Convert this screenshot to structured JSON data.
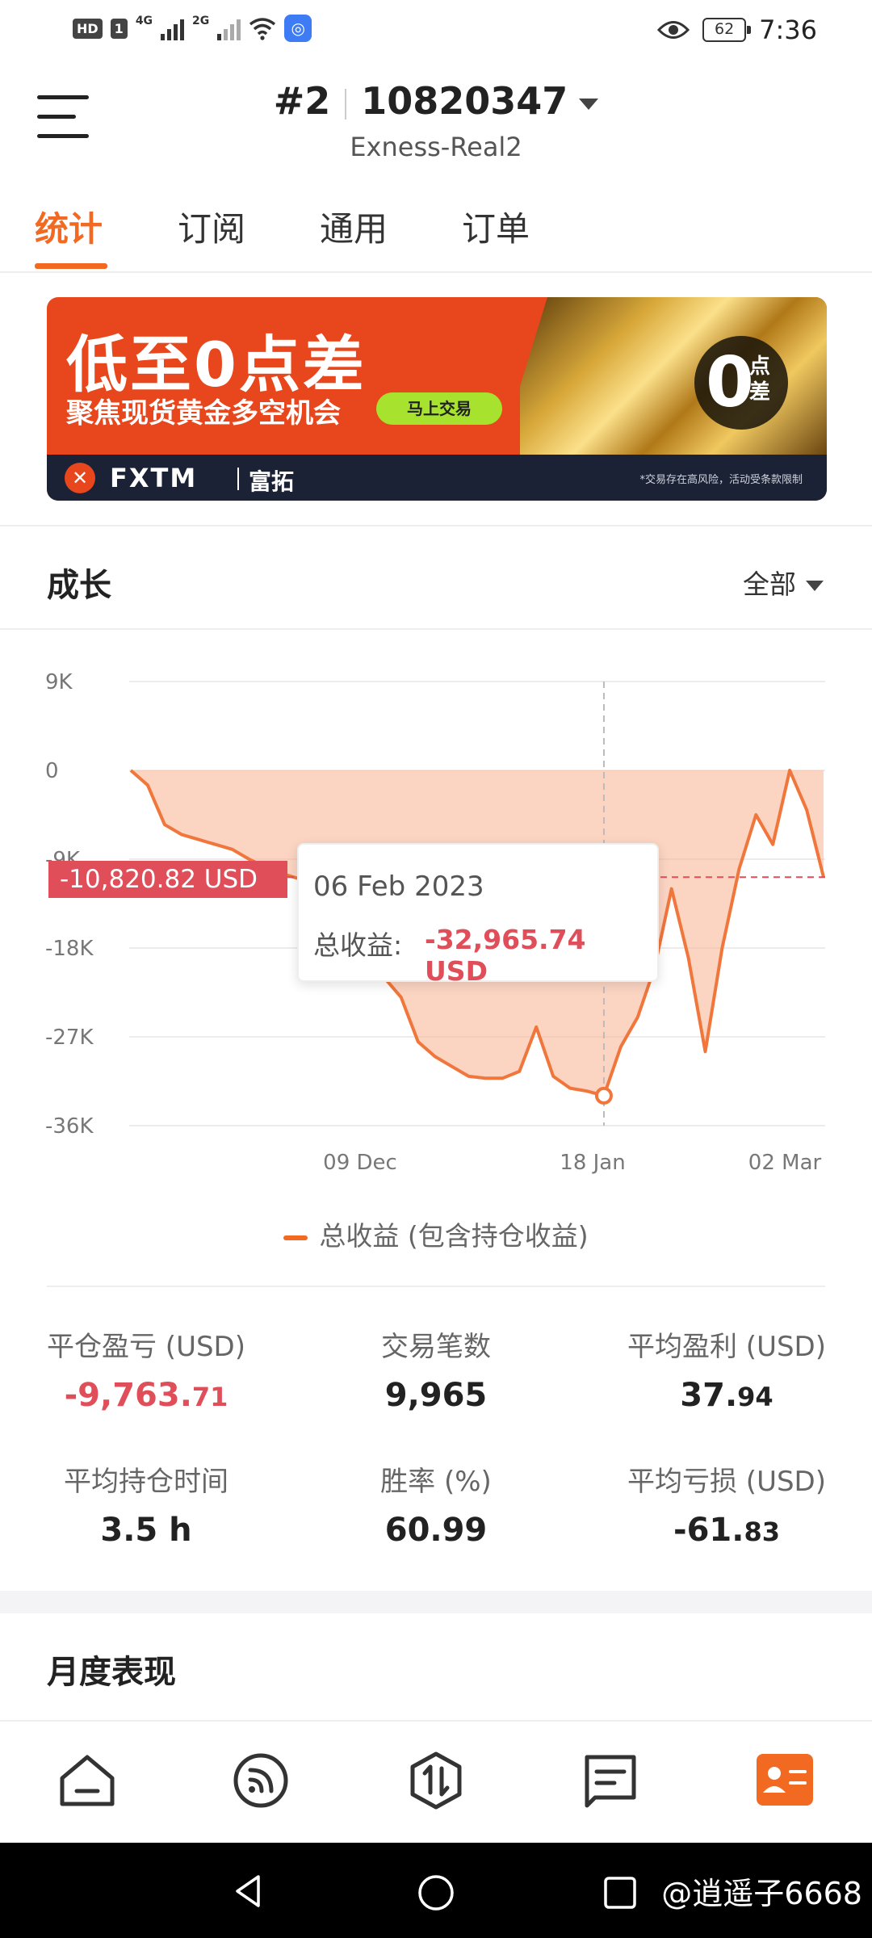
{
  "status_bar": {
    "hd": "HD",
    "sim": "1",
    "net1": "4G",
    "net2": "2G",
    "battery": "62",
    "time": "7:36"
  },
  "header": {
    "account_index": "#2",
    "account_number": "10820347",
    "server": "Exness-Real2"
  },
  "tabs": [
    {
      "label": "统计",
      "active": true
    },
    {
      "label": "订阅"
    },
    {
      "label": "通用"
    },
    {
      "label": "订单"
    }
  ],
  "banner": {
    "headline": "低至0点差",
    "subline": "聚焦现货黄金多空机会",
    "cta": "马上交易",
    "badge_big": "0",
    "badge_small": "点差",
    "brand": "FXTM",
    "brand_cn": "富拓",
    "note": "*交易存在高风险，活动受条款限制"
  },
  "growth": {
    "title": "成长",
    "range": "全部",
    "price_tag": "-10,820.82 USD",
    "tooltip_date": "06 Feb 2023",
    "tooltip_label": "总收益:",
    "tooltip_value": "-32,965.74 USD",
    "legend": "总收益 (包含持仓收益)"
  },
  "chart_data": {
    "type": "area",
    "series": [
      {
        "name": "总收益 (包含持仓收益)",
        "x": [
          "28 Oct",
          "30 Oct",
          "02 Nov",
          "05 Nov",
          "08 Nov",
          "12 Nov",
          "16 Nov",
          "20 Nov",
          "24 Nov",
          "28 Nov",
          "02 Dec",
          "09 Dec",
          "14 Dec",
          "19 Dec",
          "24 Dec",
          "29 Dec",
          "02 Jan",
          "06 Jan",
          "09 Jan",
          "12 Jan",
          "15 Jan",
          "18 Jan",
          "22 Jan",
          "25 Jan",
          "27 Jan",
          "29 Jan",
          "01 Feb",
          "04 Feb",
          "06 Feb",
          "09 Feb",
          "12 Feb",
          "15 Feb",
          "16 Feb",
          "18 Feb",
          "20 Feb",
          "22 Feb",
          "24 Feb",
          "26 Feb",
          "28 Feb",
          "01 Mar",
          "02 Mar",
          "03 Mar"
        ],
        "values": [
          0,
          -1500,
          -5500,
          -6500,
          -7000,
          -7500,
          -8000,
          -9000,
          -9800,
          -10500,
          -11000,
          -12000,
          -13500,
          -15500,
          -18500,
          -21000,
          -23000,
          -27500,
          -29000,
          -30000,
          -31000,
          -31200,
          -31200,
          -30500,
          -26000,
          -31000,
          -32200,
          -32500,
          -32966,
          -28000,
          -25000,
          -20000,
          -12000,
          -19000,
          -28500,
          -18000,
          -10000,
          -4500,
          -7500,
          0,
          -4000,
          -10821
        ]
      }
    ],
    "y_ticks": [
      "9K",
      "0",
      "-9K",
      "-18K",
      "-27K",
      "-36K"
    ],
    "x_ticks": [
      "09 Dec",
      "18 Jan",
      "02 Mar"
    ],
    "ylim": [
      -36000,
      9000
    ],
    "grid": true
  },
  "stats": [
    {
      "label": "平仓盈亏 (USD)",
      "int": "-9,763.",
      "dec": "71",
      "negative": true
    },
    {
      "label": "交易笔数",
      "int": "9,965",
      "dec": ""
    },
    {
      "label": "平均盈利 (USD)",
      "int": "37.",
      "dec": "94"
    },
    {
      "label": "平均持仓时间",
      "int": "3.5 h",
      "dec": ""
    },
    {
      "label": "胜率 (%)",
      "int": "60.99",
      "dec": ""
    },
    {
      "label": "平均亏损 (USD)",
      "int": "-61.",
      "dec": "83"
    }
  ],
  "monthly": {
    "title": "月度表现"
  },
  "colors": {
    "accent": "#f26a22",
    "negative": "#e04e5a"
  },
  "nav_icons": [
    "home-icon",
    "feed-icon",
    "trade-icon",
    "message-icon",
    "profile-card-icon"
  ],
  "watermark": "@逍遥子6668"
}
